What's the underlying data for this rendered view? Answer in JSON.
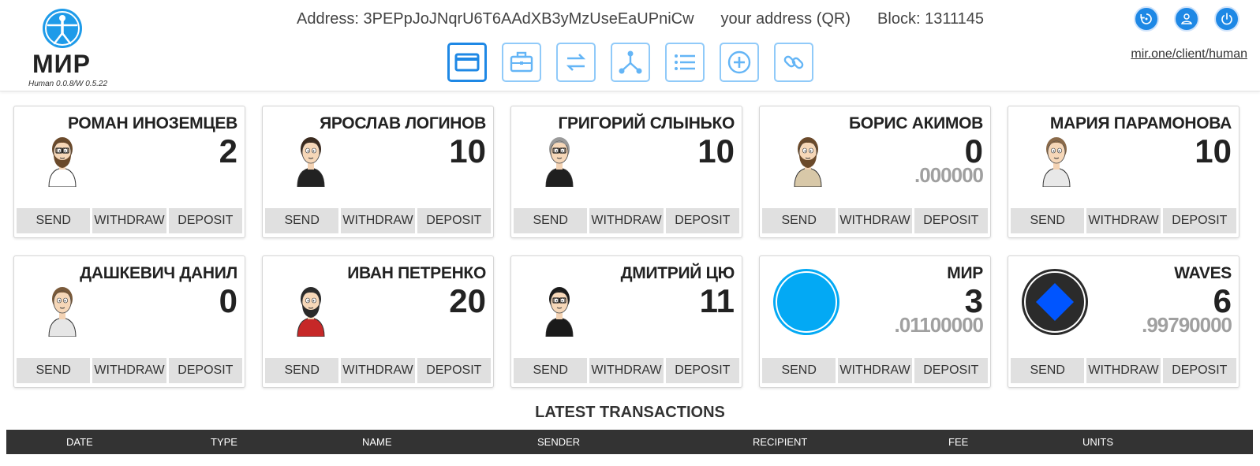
{
  "app": {
    "logo_title": "МИР",
    "version": "Human 0.0.8/W 0.5.22",
    "site_link": "mir.one/client/human"
  },
  "header": {
    "address": "Address: 3PEPpJoJNqrU6T6AAdXB3yMzUseEaUPniCw",
    "qr_link": "your address (QR)",
    "block": "Block: 1311145"
  },
  "top_icons": [
    "history-icon",
    "account-icon",
    "power-icon"
  ],
  "nav": [
    {
      "icon": "card-icon",
      "active": true
    },
    {
      "icon": "briefcase-icon",
      "active": false
    },
    {
      "icon": "exchange-icon",
      "active": false
    },
    {
      "icon": "network-icon",
      "active": false
    },
    {
      "icon": "list-icon",
      "active": false
    },
    {
      "icon": "add-circle-icon",
      "active": false
    },
    {
      "icon": "link-icon",
      "active": false
    }
  ],
  "actions": {
    "send": "SEND",
    "withdraw": "WITHDRAW",
    "deposit": "DEPOSIT"
  },
  "cards": [
    {
      "name": "РОМАН ИНОЗЕМЦЕВ",
      "amount": "2",
      "decimals": "",
      "kind": "avatar",
      "hair": "#6b4a2b",
      "shirt": "#ffffff",
      "beard": true,
      "glasses": true
    },
    {
      "name": "ЯРОСЛАВ ЛОГИНОВ",
      "amount": "10",
      "decimals": "",
      "kind": "avatar",
      "hair": "#3a2a1e",
      "shirt": "#222222",
      "beard": false,
      "glasses": false
    },
    {
      "name": "ГРИГОРИЙ СЛЫНЬКО",
      "amount": "10",
      "decimals": "",
      "kind": "avatar",
      "hair": "#9a9a9a",
      "shirt": "#1f1f1f",
      "beard": false,
      "glasses": true
    },
    {
      "name": "БОРИС АКИМОВ",
      "amount": "0",
      "decimals": ".000000",
      "kind": "avatar",
      "hair": "#6b4a2b",
      "shirt": "#d8c8a8",
      "beard": true,
      "glasses": false
    },
    {
      "name": "МАРИЯ ПАРАМОНОВА",
      "amount": "10",
      "decimals": "",
      "kind": "avatar",
      "hair": "#8a6a4a",
      "shirt": "#e8e8e8",
      "beard": false,
      "glasses": false
    },
    {
      "name": "ДАШКЕВИЧ ДАНИЛ",
      "amount": "0",
      "decimals": "",
      "kind": "avatar",
      "hair": "#7a5a3a",
      "shirt": "#e6e6e6",
      "beard": false,
      "glasses": false
    },
    {
      "name": "ИВАН ПЕТРЕНКО",
      "amount": "20",
      "decimals": "",
      "kind": "avatar",
      "hair": "#2a2a2a",
      "shirt": "#c62828",
      "beard": true,
      "glasses": false
    },
    {
      "name": "ДМИТРИЙ ЦЮ",
      "amount": "11",
      "decimals": "",
      "kind": "avatar",
      "hair": "#1a1a1a",
      "shirt": "#1a1a1a",
      "beard": false,
      "glasses": true
    },
    {
      "name": "МИР",
      "amount": "3",
      "decimals": ".01100000",
      "kind": "mir-token",
      "color": "#03a9f4"
    },
    {
      "name": "WAVES",
      "amount": "6",
      "decimals": ".99790000",
      "kind": "waves-token",
      "color": "#0055ff"
    }
  ],
  "transactions": {
    "title": "LATEST TRANSACTIONS",
    "columns": [
      "DATE",
      "TYPE",
      "NAME",
      "SENDER",
      "RECIPIENT",
      "FEE",
      "UNITS"
    ]
  },
  "colors": {
    "accent": "#1e88e5",
    "accent_light": "#90caf9",
    "table_header": "#333333"
  }
}
